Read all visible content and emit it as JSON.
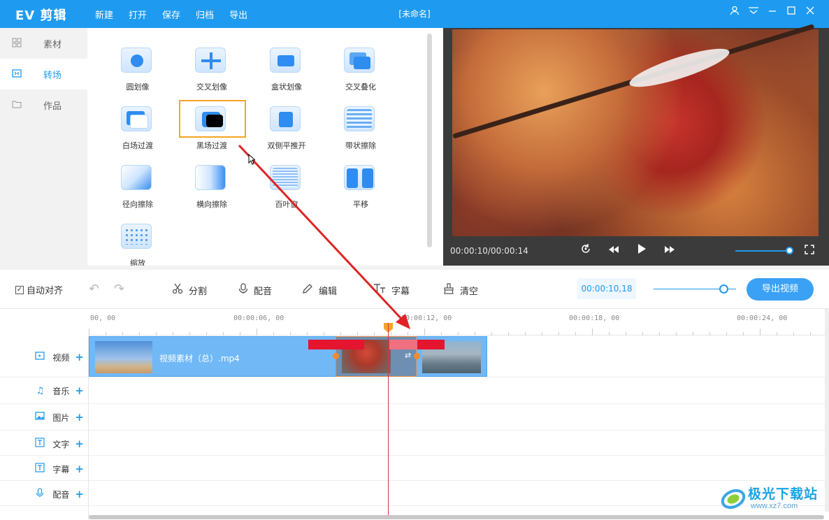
{
  "app": {
    "logo": "EV 剪辑",
    "menu": [
      "新建",
      "打开",
      "保存",
      "归档",
      "导出"
    ],
    "doc_title": "[未命名]",
    "accent_color": "#1e9bf0"
  },
  "nav": [
    {
      "label": "素材",
      "icon": "grid-icon",
      "active": false
    },
    {
      "label": "转场",
      "icon": "transition-icon",
      "active": true
    },
    {
      "label": "作品",
      "icon": "folder-icon",
      "active": false
    }
  ],
  "transitions": [
    {
      "label": "圆划像"
    },
    {
      "label": "交叉划像"
    },
    {
      "label": "盒状划像"
    },
    {
      "label": "交叉叠化"
    },
    {
      "label": "白场过渡"
    },
    {
      "label": "黑场过渡",
      "selected": true
    },
    {
      "label": "双侧平推开"
    },
    {
      "label": "带状擦除"
    },
    {
      "label": "径向擦除"
    },
    {
      "label": "横向擦除"
    },
    {
      "label": "百叶窗"
    },
    {
      "label": "平移"
    },
    {
      "label": "缩放"
    }
  ],
  "preview": {
    "timecode": "00:00:10/00:00:14",
    "controls": [
      "replay-icon",
      "rewind-icon",
      "play-icon",
      "fast-forward-icon",
      "fullscreen-icon"
    ],
    "volume": 0.92
  },
  "toolbar": {
    "auto_align": "自动对齐",
    "auto_align_checked": true,
    "split": "分割",
    "dub": "配音",
    "edit": "编辑",
    "subtitle": "字幕",
    "clear": "清空",
    "current_time": "00:00:10,18",
    "zoom": 0.8,
    "export": "导出视频"
  },
  "ruler": [
    "00, 00",
    "00:00:06, 00",
    "00:00:12, 00",
    "00:00:18, 00",
    "00:00:24, 00"
  ],
  "tracks": [
    {
      "label": "视频",
      "icon": "video-icon"
    },
    {
      "label": "音乐",
      "icon": "music-icon"
    },
    {
      "label": "图片",
      "icon": "image-icon"
    },
    {
      "label": "文字",
      "icon": "text-icon"
    },
    {
      "label": "字幕",
      "icon": "subtitle-icon"
    },
    {
      "label": "配音",
      "icon": "mic-icon"
    }
  ],
  "clip": {
    "name": "视频素材（总）.mp4"
  },
  "watermark": {
    "title": "极光下载站",
    "url": "www.xz7.com"
  }
}
